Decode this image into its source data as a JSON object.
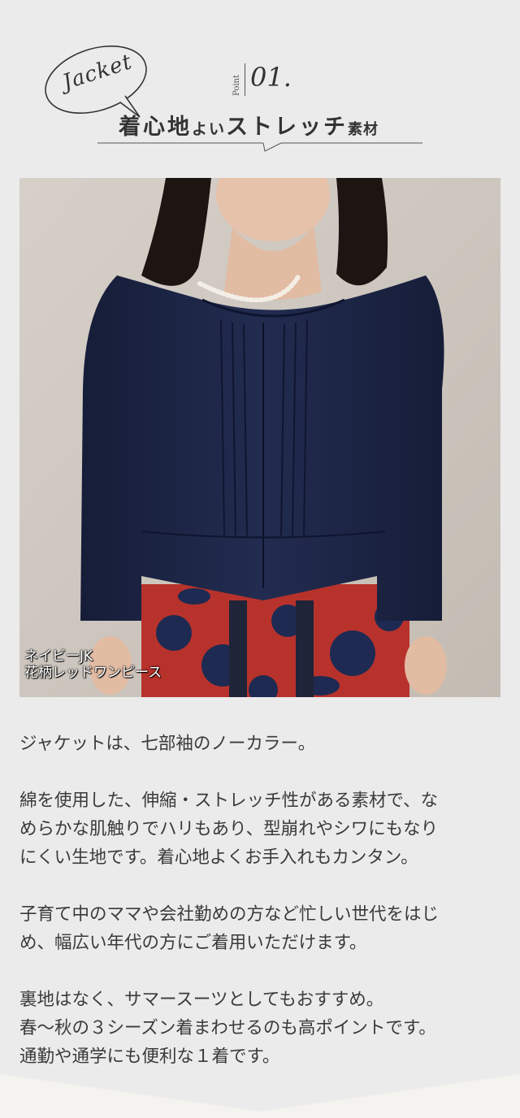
{
  "header": {
    "badge_text": "Jacket",
    "point_label": "Point",
    "point_number": "01.",
    "headline_part1": "着心地",
    "headline_part2": "よい",
    "headline_part3": "ストレッチ",
    "headline_part4": "素材"
  },
  "photo": {
    "caption_line1": "ネイビーJK",
    "caption_line2": "花柄レッドワンピース"
  },
  "description": {
    "paragraphs": [
      [
        "ジャケットは、七部袖のノーカラー。"
      ],
      [
        "綿を使用した、伸縮・ストレッチ性がある素材で、な",
        "めらかな肌触りでハリもあり、型崩れやシワにもなり",
        "にくい生地です。着心地よくお手入れもカンタン。"
      ],
      [
        "子育て中のママや会社勤めの方など忙しい世代をはじ",
        "め、幅広い年代の方にご着用いただけます。"
      ],
      [
        "裏地はなく、サマースーツとしてもおすすめ。",
        "春〜秋の３シーズン着まわせるのも高ポイントです。",
        "通勤や通学にも便利な１着です。"
      ]
    ]
  },
  "colors": {
    "background": "#ebebeb",
    "text": "#333333",
    "jacket_navy": "#1c2545",
    "dress_red": "#b8322c"
  }
}
